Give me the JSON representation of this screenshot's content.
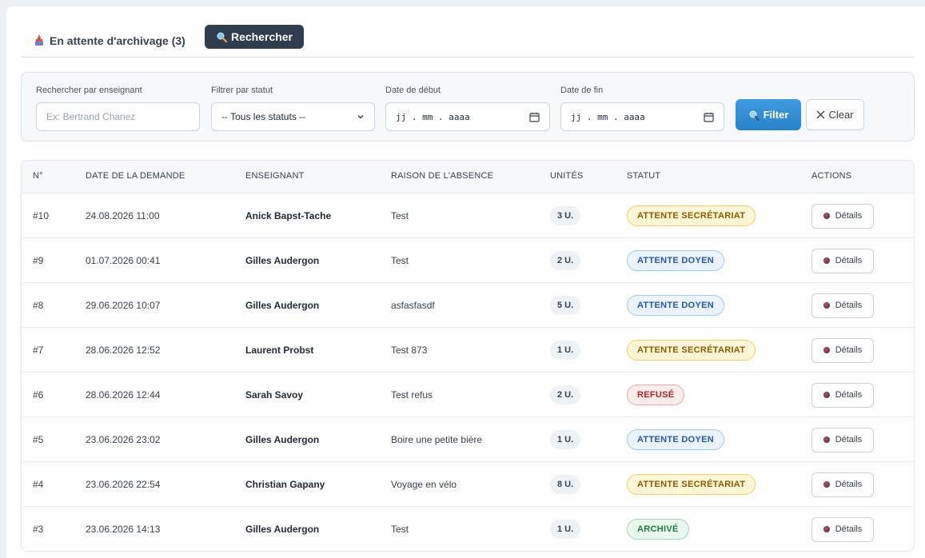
{
  "tabs": {
    "archive_label": "En attente d'archivage (3)",
    "search_label": "Rechercher"
  },
  "filters": {
    "teacher_label": "Rechercher par enseignant",
    "teacher_placeholder": "Ex: Bertrand Chanez",
    "status_label": "Filtrer par statut",
    "status_value": "-- Tous les statuts --",
    "start_label": "Date de début",
    "start_value": "jj . mm . aaaa",
    "end_label": "Date de fin",
    "end_value": "jj . mm . aaaa",
    "filter_button": "Filter",
    "clear_button": "Clear"
  },
  "table": {
    "headers": [
      "N°",
      "DATE DE LA DEMANDE",
      "ENSEIGNANT",
      "RAISON DE L'ABSENCE",
      "UNITÉS",
      "STATUT",
      "ACTIONS"
    ],
    "details_label": "Détails",
    "rows": [
      {
        "id": "#10",
        "date": "24.08.2026 11:00",
        "teacher": "Anick Bapst-Tache",
        "reason": "Test",
        "units": "3 U.",
        "status": "ATTENTE SECRÉTARIAT",
        "status_kind": "sec"
      },
      {
        "id": "#9",
        "date": "01.07.2026 00:41",
        "teacher": "Gilles Audergon",
        "reason": "Test",
        "units": "2 U.",
        "status": "ATTENTE DOYEN",
        "status_kind": "doyen"
      },
      {
        "id": "#8",
        "date": "29.06.2026 10:07",
        "teacher": "Gilles Audergon",
        "reason": "asfasfasdf",
        "units": "5 U.",
        "status": "ATTENTE DOYEN",
        "status_kind": "doyen"
      },
      {
        "id": "#7",
        "date": "28.06.2026 12:52",
        "teacher": "Laurent Probst",
        "reason": "Test 873",
        "units": "1 U.",
        "status": "ATTENTE SECRÉTARIAT",
        "status_kind": "sec"
      },
      {
        "id": "#6",
        "date": "28.06.2026 12:44",
        "teacher": "Sarah Savoy",
        "reason": "Test refus",
        "units": "2 U.",
        "status": "REFUSÉ",
        "status_kind": "refuse"
      },
      {
        "id": "#5",
        "date": "23.06.2026 23:02",
        "teacher": "Gilles Audergon",
        "reason": "Boire une petite bière",
        "units": "1 U.",
        "status": "ATTENTE DOYEN",
        "status_kind": "doyen"
      },
      {
        "id": "#4",
        "date": "23.06.2026 22:54",
        "teacher": "Christian Gapany",
        "reason": "Voyage en vélo",
        "units": "8 U.",
        "status": "ATTENTE SECRÉTARIAT",
        "status_kind": "sec"
      },
      {
        "id": "#3",
        "date": "23.06.2026 14:13",
        "teacher": "Gilles Audergon",
        "reason": "Test",
        "units": "1 U.",
        "status": "ARCHIVÉ",
        "status_kind": "archive"
      }
    ]
  }
}
